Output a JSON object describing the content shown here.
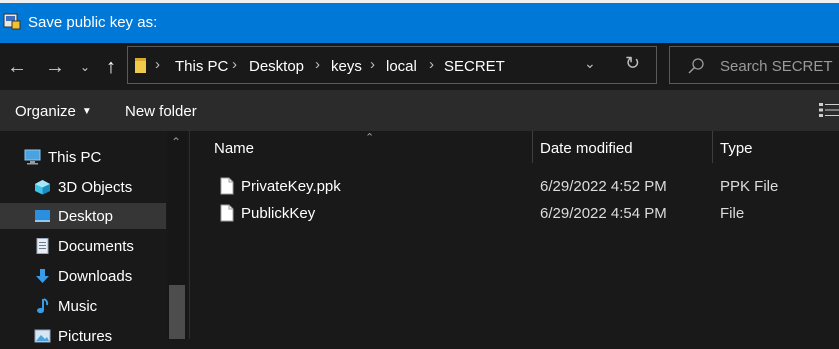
{
  "window": {
    "title": "Save public key as:"
  },
  "address_bar": {
    "breadcrumbs": [
      "This PC",
      "Desktop",
      "keys",
      "local",
      "SECRET"
    ]
  },
  "search": {
    "placeholder": "Search SECRET"
  },
  "toolbar": {
    "organize_label": "Organize",
    "new_folder_label": "New folder"
  },
  "nav_pane": {
    "items": [
      {
        "label": "This PC",
        "icon": "computer-icon"
      },
      {
        "label": "3D Objects",
        "icon": "3d-objects-icon"
      },
      {
        "label": "Desktop",
        "icon": "desktop-icon",
        "selected": true
      },
      {
        "label": "Documents",
        "icon": "documents-icon"
      },
      {
        "label": "Downloads",
        "icon": "downloads-icon"
      },
      {
        "label": "Music",
        "icon": "music-icon"
      },
      {
        "label": "Pictures",
        "icon": "pictures-icon"
      }
    ]
  },
  "file_list": {
    "columns": [
      "Name",
      "Date modified",
      "Type"
    ],
    "rows": [
      {
        "name": "PrivateKey.ppk",
        "date": "6/29/2022 4:52 PM",
        "type": "PPK File"
      },
      {
        "name": "PublickKey",
        "date": "6/29/2022 4:54 PM",
        "type": "File"
      }
    ]
  },
  "colors": {
    "titlebar": "#0078d7",
    "background": "#191919",
    "toolbar": "#2b2b2b",
    "selected": "#363636",
    "folder": "#f0c94b"
  }
}
